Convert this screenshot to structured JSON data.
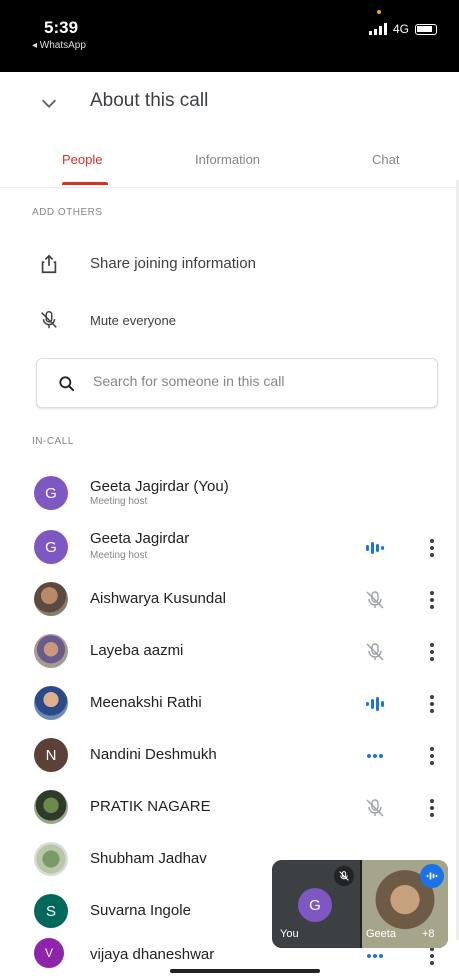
{
  "status_bar": {
    "time": "5:39",
    "back_app": "◂ WhatsApp",
    "network": "4G"
  },
  "header": {
    "title": "About this call"
  },
  "tabs": [
    {
      "label": "People",
      "active": true
    },
    {
      "label": "Information",
      "active": false
    },
    {
      "label": "Chat",
      "active": false
    }
  ],
  "add_others": {
    "section_label": "ADD OTHERS",
    "share_label": "Share joining information",
    "mute_label": "Mute everyone"
  },
  "search": {
    "placeholder": "Search for someone in this call",
    "value": ""
  },
  "in_call": {
    "section_label": "IN-CALL",
    "participants": [
      {
        "name": "Geeta Jagirdar (You)",
        "subtitle": "Meeting host",
        "avatar_letter": "G",
        "avatar_color": "#7e57c2",
        "status": "none"
      },
      {
        "name": "Geeta Jagirdar",
        "subtitle": "Meeting host",
        "avatar_letter": "G",
        "avatar_color": "#7e57c2",
        "status": "speaking"
      },
      {
        "name": "Aishwarya Kusundal",
        "subtitle": "",
        "avatar_letter": "",
        "avatar_color": "",
        "status": "muted"
      },
      {
        "name": "Layeba aazmi",
        "subtitle": "",
        "avatar_letter": "",
        "avatar_color": "",
        "status": "muted"
      },
      {
        "name": "Meenakshi Rathi",
        "subtitle": "",
        "avatar_letter": "",
        "avatar_color": "",
        "status": "speaking"
      },
      {
        "name": "Nandini Deshmukh",
        "subtitle": "",
        "avatar_letter": "N",
        "avatar_color": "#5d4037",
        "status": "connecting"
      },
      {
        "name": "PRATIK NAGARE",
        "subtitle": "",
        "avatar_letter": "",
        "avatar_color": "",
        "status": "muted"
      },
      {
        "name": "Shubham Jadhav",
        "subtitle": "",
        "avatar_letter": "",
        "avatar_color": "",
        "status": "muted"
      },
      {
        "name": "Suvarna Ingole",
        "subtitle": "",
        "avatar_letter": "S",
        "avatar_color": "#00695c",
        "status": "none"
      },
      {
        "name": "vijaya dhaneshwar",
        "subtitle": "",
        "avatar_letter": "V",
        "avatar_color": "#8e24aa",
        "status": "connecting"
      }
    ]
  },
  "pip": {
    "you_label": "You",
    "you_letter": "G",
    "other_label": "Geeta",
    "more_label": "+8"
  },
  "colors": {
    "accent_red": "#d93025",
    "speaking_blue": "#1a73e8",
    "muted_gray": "#9aa0a6"
  }
}
